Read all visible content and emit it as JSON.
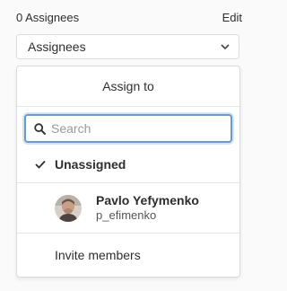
{
  "header": {
    "count_label": "0 Assignees",
    "edit_label": "Edit"
  },
  "dropdown": {
    "toggle_label": "Assignees",
    "icon": "chevron-down-icon"
  },
  "menu": {
    "title": "Assign to",
    "search": {
      "placeholder": "Search",
      "value": "",
      "icon": "search-icon"
    },
    "unassigned": {
      "label": "Unassigned",
      "selected": true,
      "icon": "check-icon"
    },
    "users": [
      {
        "name": "Pavlo Yefymenko",
        "username": "p_efimenko",
        "avatar": "avatar-photo"
      }
    ],
    "invite_label": "Invite members"
  },
  "colors": {
    "focus_border": "#6b9ac8",
    "focus_ring": "#d6e4f2",
    "text": "#2e2e2e",
    "divider": "#e5e5e5"
  }
}
